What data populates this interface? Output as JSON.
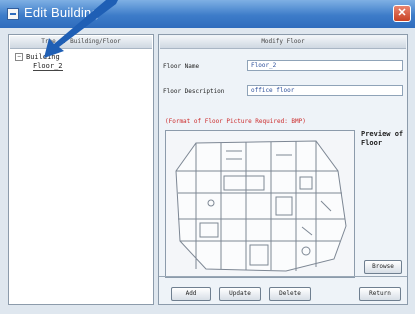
{
  "window": {
    "title": "Edit Building"
  },
  "tree_panel": {
    "header": "Tree of Building/Floor",
    "root_label": "Building",
    "toggle_symbol": "−",
    "child_label": "Floor_2"
  },
  "modify_panel": {
    "header": "Modify Floor",
    "floor_name_label": "Floor Name",
    "floor_name_value": "Floor_2",
    "floor_description_label": "Floor Description",
    "floor_description_value": "office floor",
    "format_note": "(Format of Floor Picture Required: BMP)",
    "preview_label": "Preview of Floor",
    "browse_label": "Browse"
  },
  "buttons": {
    "add": "Add",
    "update": "Update",
    "delete": "Delete",
    "return": "Return"
  },
  "colors": {
    "title_bar": "#3d7cc9",
    "format_note": "#cc2a2a",
    "pointer": "#1f5fb5"
  }
}
